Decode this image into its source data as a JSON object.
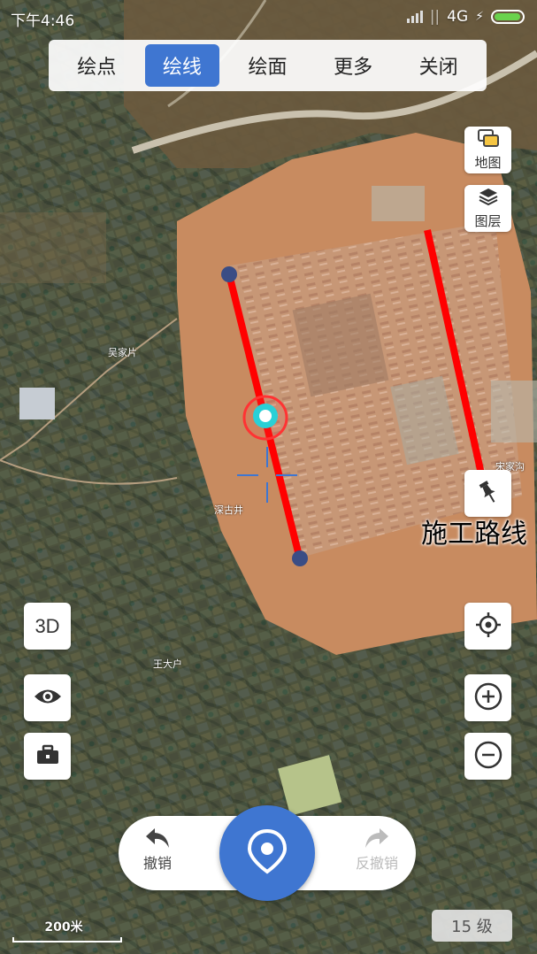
{
  "status_bar": {
    "time": "下午4:46",
    "network": "4G"
  },
  "mode_bar": {
    "items": [
      "绘点",
      "绘线",
      "绘面",
      "更多",
      "关闭"
    ],
    "active_index": 1
  },
  "right_buttons": {
    "basemap": "地图",
    "layers": "图层"
  },
  "left_buttons": {
    "three_d": "3D"
  },
  "map_labels": {
    "wujiapian": "吴家片",
    "shenguijing": "深古井",
    "wangdahu": "王大户",
    "songjiagou": "宋家沟"
  },
  "annotation": {
    "label": "施工路线"
  },
  "bottom_bar": {
    "undo": "撤销",
    "redo": "反撤销"
  },
  "scale_bar": {
    "label": "200米"
  },
  "zoom_level": "15 级",
  "colors": {
    "accent": "#3f76d1",
    "route": "#ff0000",
    "vertex": "#3a4d85"
  },
  "icons": [
    "signal-icon",
    "charging-icon",
    "battery-icon",
    "basemap-icon",
    "layers-icon",
    "pin-icon",
    "locate-icon",
    "zoom-in-icon",
    "zoom-out-icon",
    "eye-icon",
    "toolbox-icon",
    "undo-icon",
    "redo-icon",
    "location-pin-icon"
  ]
}
